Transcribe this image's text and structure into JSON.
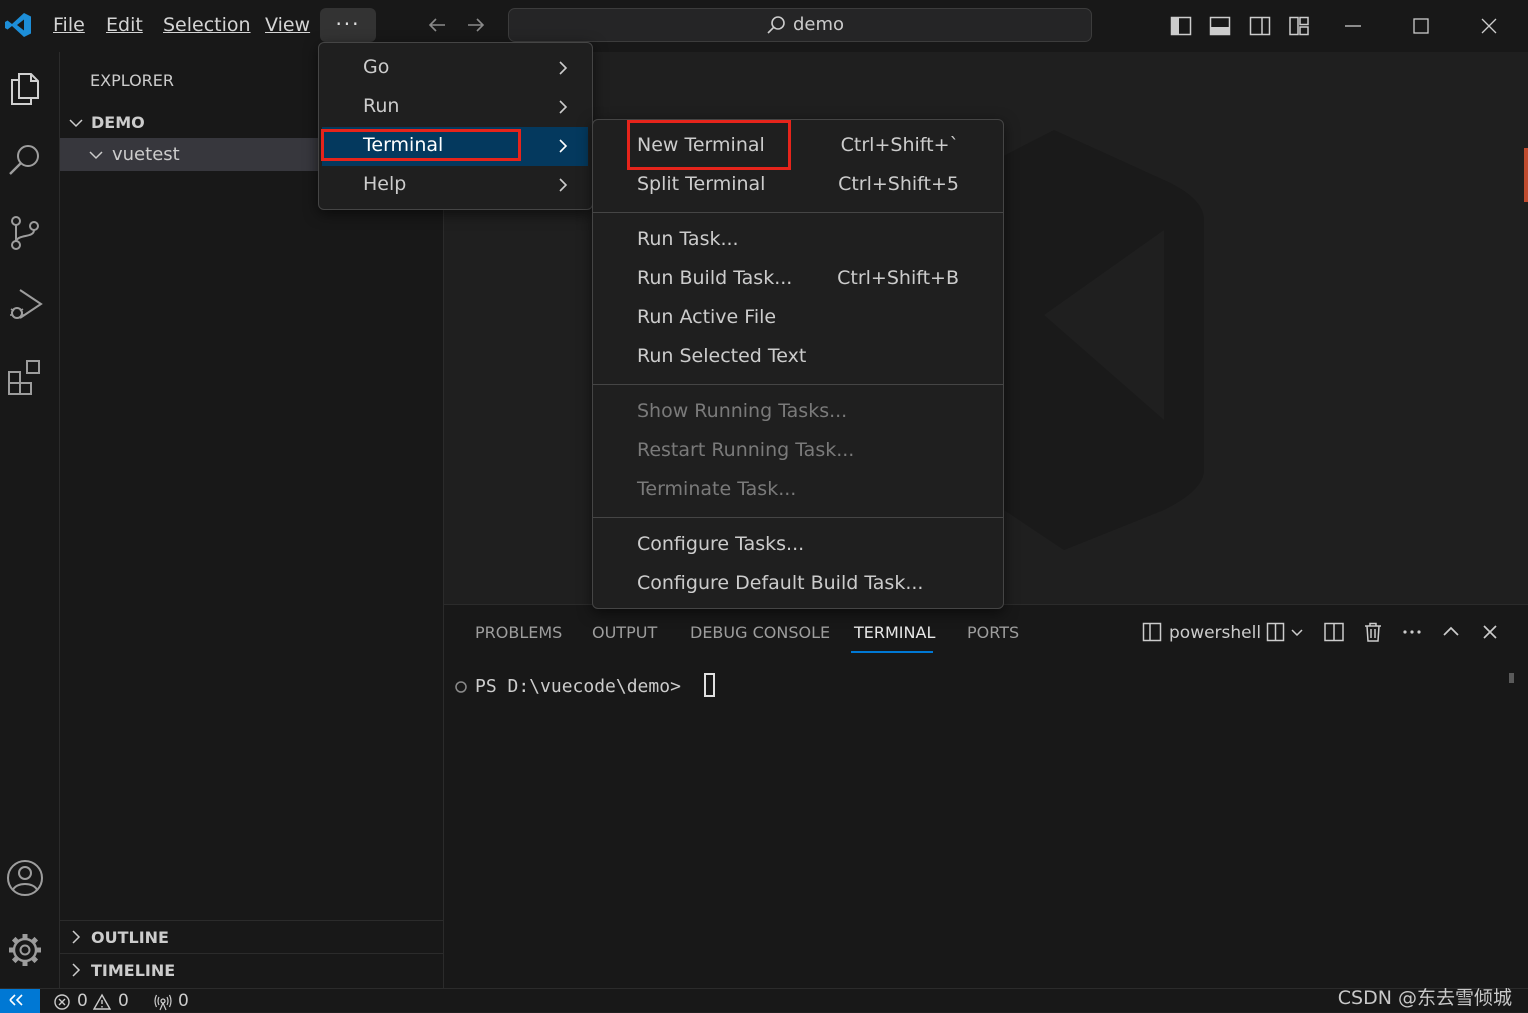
{
  "title_bar": {
    "menus": [
      "File",
      "Edit",
      "Selection",
      "View"
    ],
    "more_label": "···",
    "search_label": "demo"
  },
  "activity_bar": {
    "icons": [
      "files-icon",
      "search-icon",
      "source-control-icon",
      "run-debug-icon",
      "extensions-icon",
      "account-icon",
      "settings-gear-icon"
    ]
  },
  "sidebar": {
    "title": "EXPLORER",
    "section": "DEMO",
    "folder": "vuetest",
    "outline": "OUTLINE",
    "timeline": "TIMELINE"
  },
  "more_menu": {
    "items": [
      {
        "label": "Go"
      },
      {
        "label": "Run"
      },
      {
        "label": "Terminal",
        "active": true
      },
      {
        "label": "Help"
      }
    ]
  },
  "terminal_menu": {
    "groups": [
      [
        {
          "label": "New Terminal",
          "shortcut": "Ctrl+Shift+`",
          "highlighted": true
        },
        {
          "label": "Split Terminal",
          "shortcut": "Ctrl+Shift+5"
        }
      ],
      [
        {
          "label": "Run Task...",
          "shortcut": ""
        },
        {
          "label": "Run Build Task...",
          "shortcut": "Ctrl+Shift+B"
        },
        {
          "label": "Run Active File",
          "shortcut": ""
        },
        {
          "label": "Run Selected Text",
          "shortcut": ""
        }
      ],
      [
        {
          "label": "Show Running Tasks...",
          "disabled": true
        },
        {
          "label": "Restart Running Task...",
          "disabled": true
        },
        {
          "label": "Terminate Task...",
          "disabled": true
        }
      ],
      [
        {
          "label": "Configure Tasks...",
          "shortcut": ""
        },
        {
          "label": "Configure Default Build Task...",
          "shortcut": ""
        }
      ]
    ]
  },
  "panel": {
    "tabs": [
      "PROBLEMS",
      "OUTPUT",
      "DEBUG CONSOLE",
      "TERMINAL",
      "PORTS"
    ],
    "active_tab": "TERMINAL",
    "terminal_profile": "powershell",
    "prompt": "PS D:\\vuecode\\demo> "
  },
  "status_bar": {
    "errors": "0",
    "warnings": "0",
    "ports": "0",
    "watermark": "CSDN @东去雪倾城"
  },
  "colors": {
    "accent": "#0078d4",
    "highlight_box": "#e6241b",
    "menu_active": "#04395e"
  }
}
